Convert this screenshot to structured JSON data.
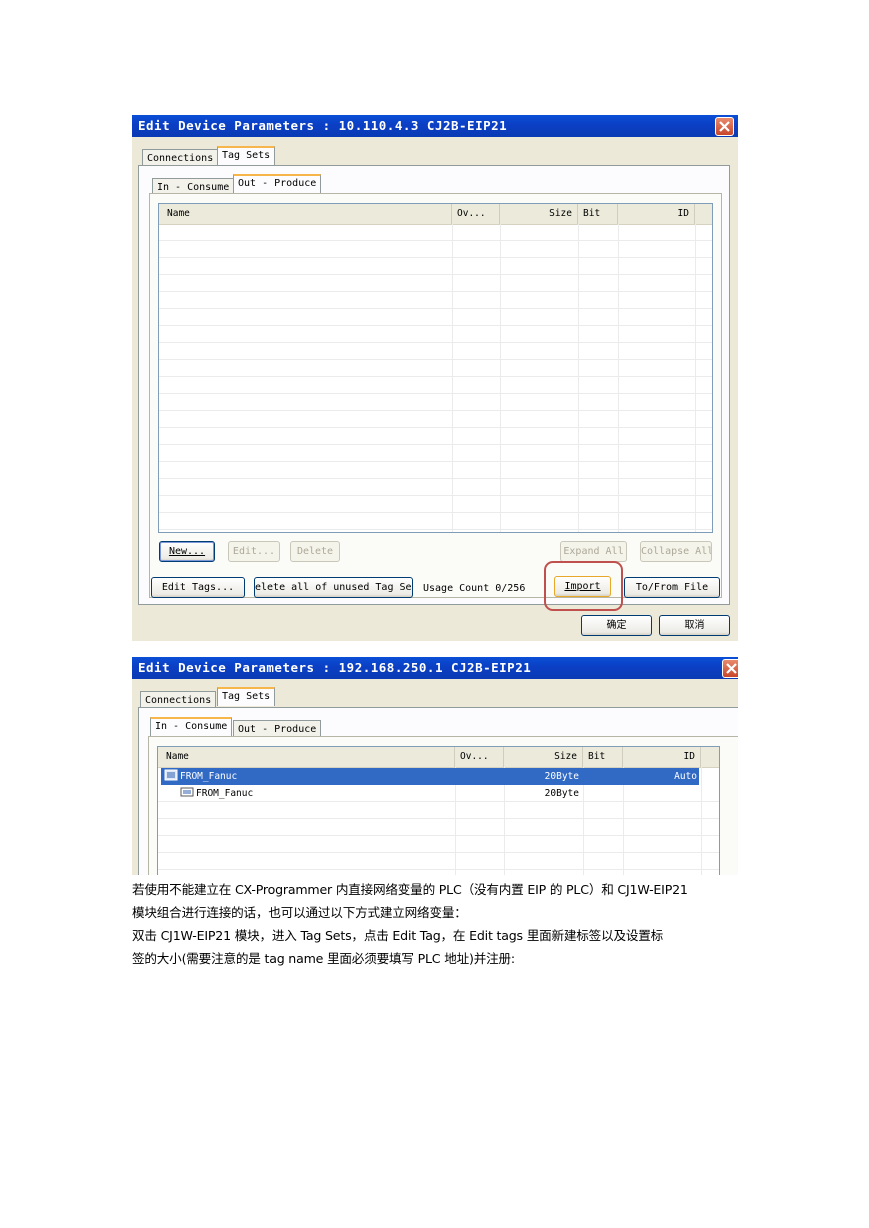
{
  "dialog1": {
    "title": "Edit Device Parameters : 10.110.4.3 CJ2B-EIP21",
    "tabs": [
      "Connections",
      "Tag Sets"
    ],
    "subtabs": [
      "In - Consume",
      "Out - Produce"
    ],
    "columns": [
      "Name",
      "Ov...",
      "Size",
      "Bit",
      "ID"
    ],
    "buttons": {
      "new": "New...",
      "edit": "Edit...",
      "delete": "Delete",
      "expand_all": "Expand All",
      "collapse_all": "Collapse All",
      "edit_tags": "Edit Tags...",
      "delete_unused": "elete all of unused Tag Set",
      "import": "Import",
      "to_from_file": "To/From File",
      "ok": "确定",
      "cancel": "取消"
    },
    "usage_count": "Usage Count 0/256"
  },
  "dialog2": {
    "title": "Edit Device Parameters : 192.168.250.1 CJ2B-EIP21",
    "tabs": [
      "Connections",
      "Tag Sets"
    ],
    "subtabs": [
      "In - Consume",
      "Out - Produce"
    ],
    "columns": [
      "Name",
      "Ov...",
      "Size",
      "Bit",
      "ID"
    ],
    "rows": [
      {
        "name": "FROM_Fanuc",
        "size": "20Byte",
        "id": "Auto",
        "selected": true
      },
      {
        "name": "FROM_Fanuc",
        "size": "20Byte",
        "id": "",
        "selected": false
      }
    ]
  },
  "text": {
    "line1": "若使用不能建立在 CX-Programmer 内直接网络变量的 PLC（没有内置 EIP 的 PLC）和 CJ1W-EIP21",
    "line2": "模块组合进行连接的话，也可以通过以下方式建立网络变量：",
    "line3": "双击 CJ1W-EIP21 模块，进入 Tag Sets，点击 Edit Tag，在 Edit tags 里面新建标签以及设置标",
    "line4": "签的大小(需要注意的是 tag name 里面必须要填写 PLC 地址)并注册:"
  }
}
